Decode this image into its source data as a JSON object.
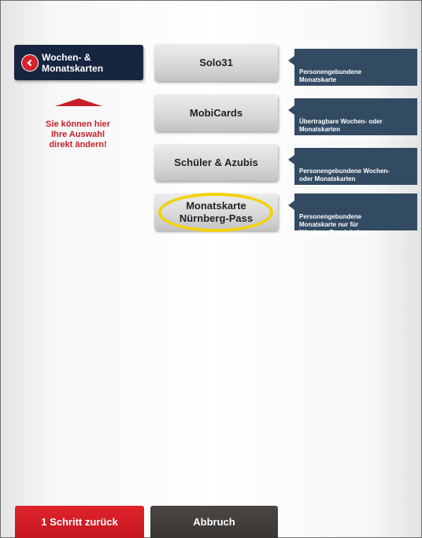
{
  "back_button": {
    "label": "Wochen- &\nMonatskarten",
    "icon": "chevron-left-icon"
  },
  "hint": "Sie können hier\nIhre Auswahl\ndirekt ändern!",
  "products": [
    {
      "label": "Solo31",
      "info": "Personengebundene\nMonatskarte"
    },
    {
      "label": "MobiCards",
      "info": "Übertragbare Wochen- oder\nMonatskarten"
    },
    {
      "label": "Schüler & Azubis",
      "info": "Personengebundene Wochen-\noder Monatskarten"
    },
    {
      "label": "Monatskarte\nNürnberg-Pass",
      "info": "Personengebundene\nMonatskarte nur für\nNürnberg-Passinhaber"
    }
  ],
  "footer": {
    "back_label": "1 Schritt zurück",
    "cancel_label": "Abbruch"
  },
  "colors": {
    "accent_red": "#c8202a",
    "navy": "#172640",
    "info_blue": "#334a63",
    "highlight": "#f2d20a"
  }
}
